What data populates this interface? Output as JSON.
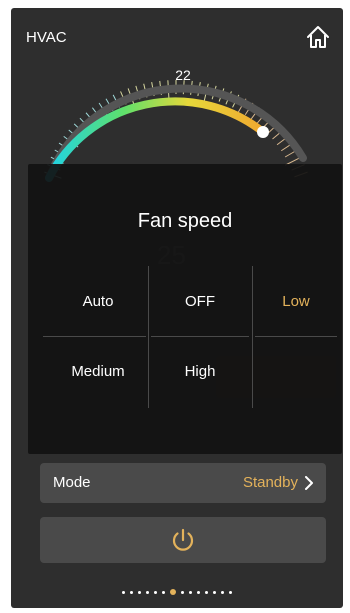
{
  "header": {
    "title": "HVAC",
    "home_icon": "home-icon"
  },
  "thermostat": {
    "setpoint": "22",
    "current_hint": "25"
  },
  "fan_speed_popup": {
    "title": "Fan speed",
    "options": [
      "Auto",
      "OFF",
      "Low",
      "Medium",
      "High"
    ],
    "selected": "Low"
  },
  "mode_row": {
    "label": "Mode",
    "value": "Standby",
    "chevron_icon": "chevron-right-icon"
  },
  "power": {
    "icon": "power-icon"
  },
  "pager": {
    "total": 14,
    "active_index": 6
  },
  "colors": {
    "accent": "#e3b25b",
    "panel": "#2e2e2e",
    "row": "#4a4a4a",
    "arc_start": "#1fd3e6",
    "arc_mid": "#e6d83a",
    "arc_end": "#f0a830"
  }
}
